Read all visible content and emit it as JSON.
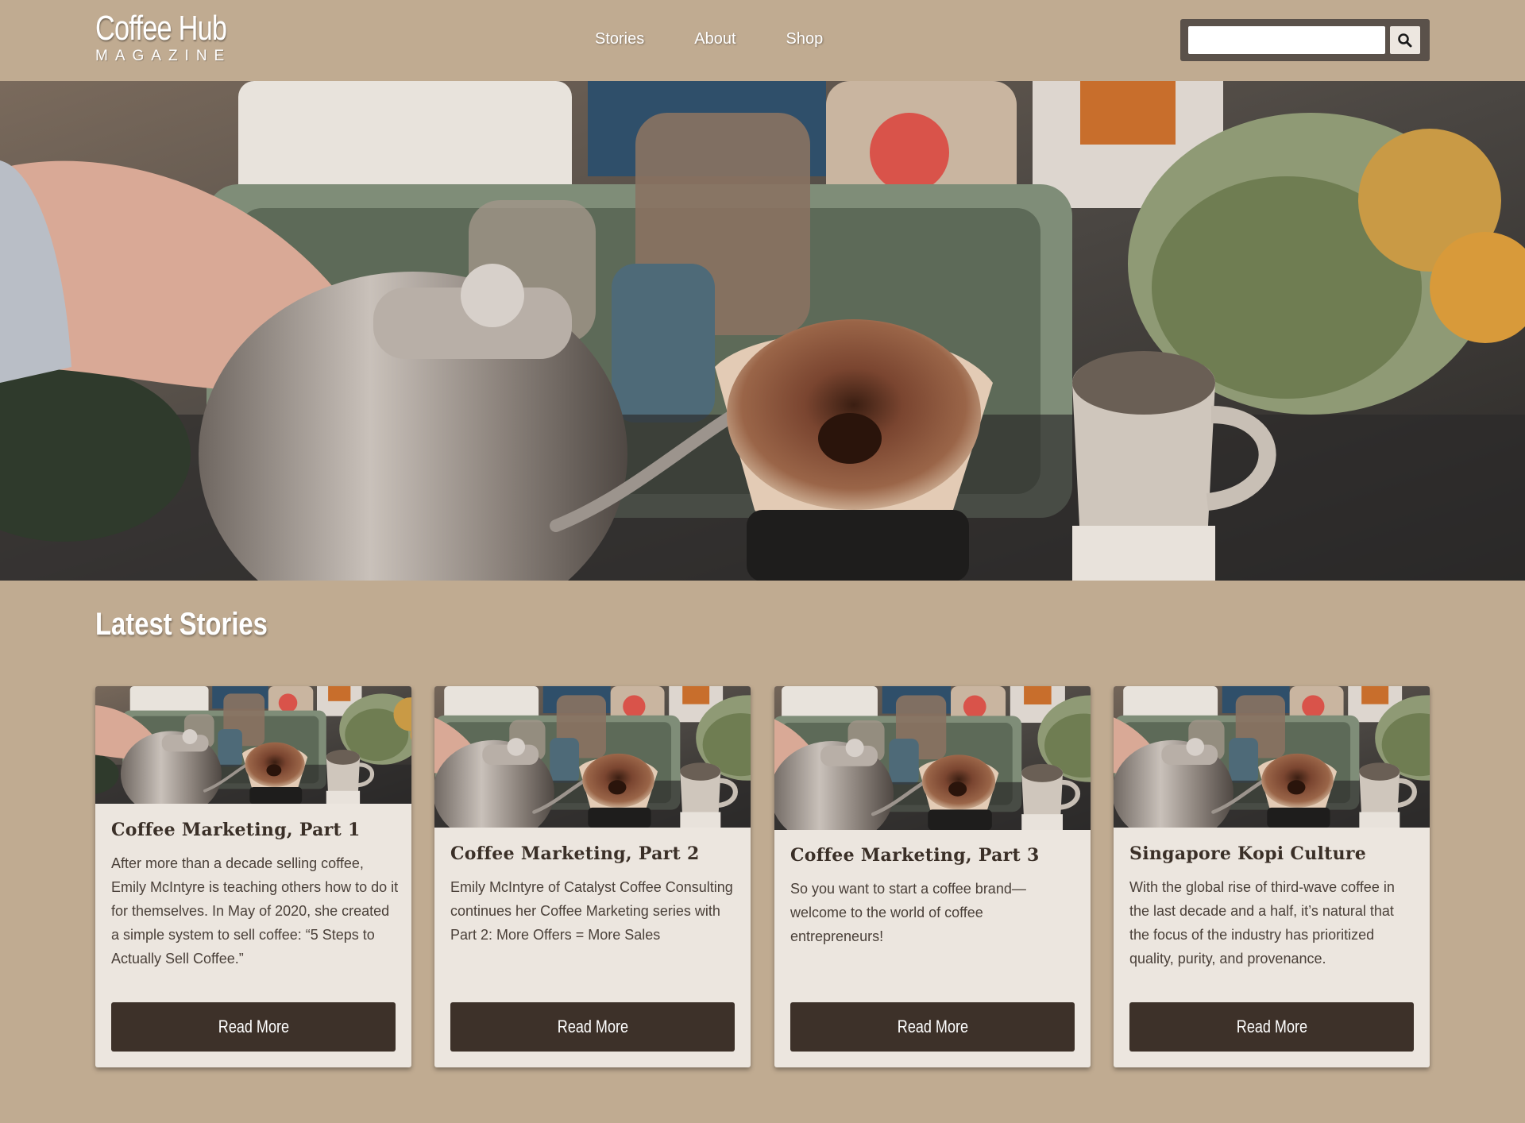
{
  "brand": {
    "title": "Coffee Hub",
    "subtitle": "MAGAZINE"
  },
  "nav": {
    "items": [
      {
        "label": "Stories"
      },
      {
        "label": "About"
      },
      {
        "label": "Shop"
      }
    ]
  },
  "search": {
    "placeholder": "",
    "value": "",
    "icon": "search-icon"
  },
  "hero": {
    "image": "pour-over-coffee-photo"
  },
  "section": {
    "title": "Latest Stories"
  },
  "cards": [
    {
      "title": "Coffee Marketing, Part 1",
      "text": "After more than a decade selling coffee, Emily McIntyre is teaching others how to do it for themselves. In May of 2020, she created a simple system to sell coffee: “5 Steps to Actually Sell Coffee.”",
      "button": "Read More"
    },
    {
      "title": "Coffee Marketing, Part 2",
      "text": "Emily McIntyre of Catalyst Coffee Consulting continues her Coffee Marketing series with Part 2: More Offers = More Sales",
      "button": "Read More"
    },
    {
      "title": "Coffee Marketing, Part 3",
      "text": "So you want to start a coffee brand—welcome to the world of coffee entrepreneurs!",
      "button": "Read More"
    },
    {
      "title": "Singapore Kopi Culture",
      "text": "With the global rise of third-wave coffee in the last decade and a half, it’s natural that the focus of the industry has prioritized quality, purity, and provenance.",
      "button": "Read More"
    }
  ],
  "colors": {
    "background": "#c0ab91",
    "card": "#ece6df",
    "button": "#3d3129",
    "search_frame": "#5a514a"
  }
}
